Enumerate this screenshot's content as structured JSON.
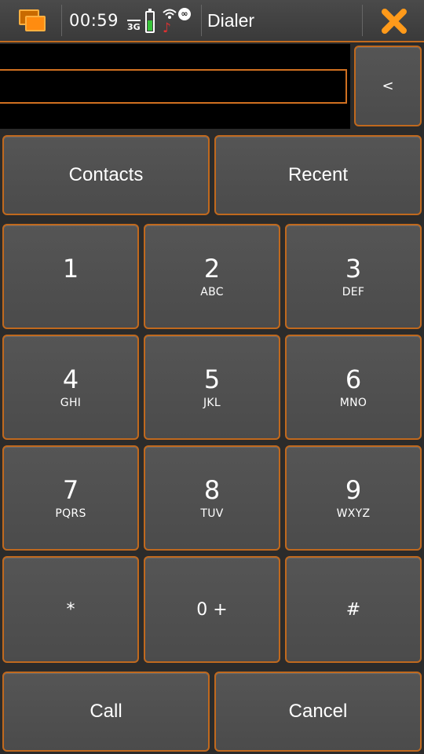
{
  "status": {
    "clock": "00:59",
    "network": "3G",
    "battery_level": 0.6,
    "app_title": "Dialer"
  },
  "display": {
    "number": "",
    "backspace_label": "<"
  },
  "actions": {
    "contacts_label": "Contacts",
    "recent_label": "Recent",
    "call_label": "Call",
    "cancel_label": "Cancel"
  },
  "keypad": [
    {
      "digit": "1",
      "letters": ""
    },
    {
      "digit": "2",
      "letters": "ABC"
    },
    {
      "digit": "3",
      "letters": "DEF"
    },
    {
      "digit": "4",
      "letters": "GHI"
    },
    {
      "digit": "5",
      "letters": "JKL"
    },
    {
      "digit": "6",
      "letters": "MNO"
    },
    {
      "digit": "7",
      "letters": "PQRS"
    },
    {
      "digit": "8",
      "letters": "TUV"
    },
    {
      "digit": "9",
      "letters": "WXYZ"
    },
    {
      "digit": "*",
      "letters": ""
    },
    {
      "digit": "0 +",
      "letters": ""
    },
    {
      "digit": "#",
      "letters": ""
    }
  ],
  "colors": {
    "accent": "#c0691e",
    "button": "#4f4f4f",
    "background": "#2b2b2b",
    "close": "#ff9a1a"
  }
}
